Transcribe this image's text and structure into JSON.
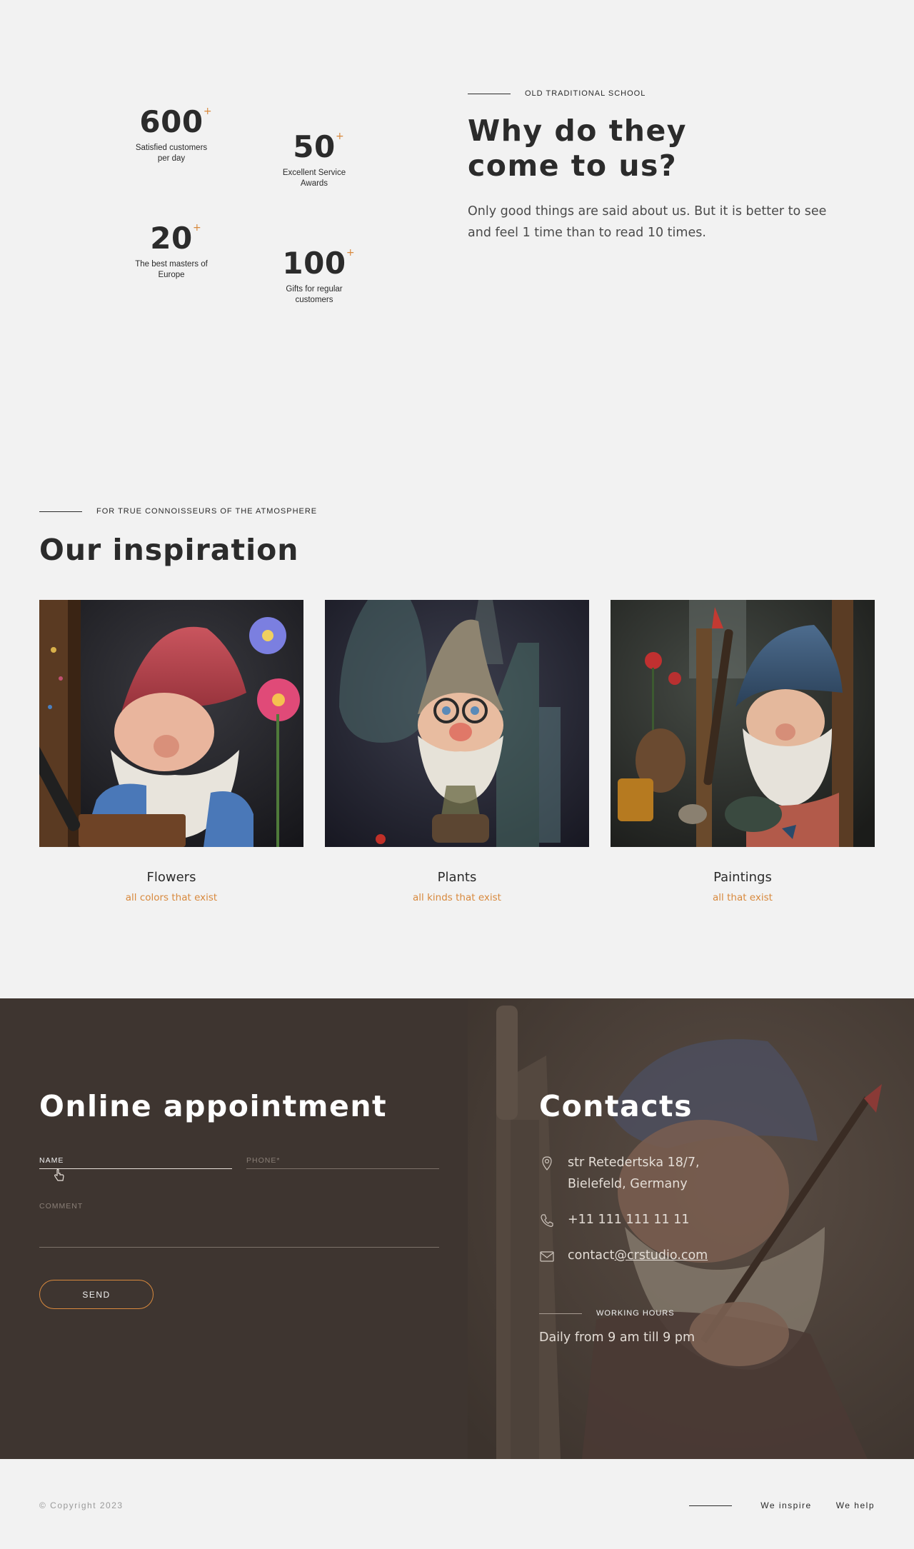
{
  "stats": [
    {
      "number": "600",
      "plus": "+",
      "caption_line1": "Satisfied customers",
      "caption_line2": "per day"
    },
    {
      "number": "50",
      "plus": "+",
      "caption_line1": "Excellent Service",
      "caption_line2": "Awards"
    },
    {
      "number": "20",
      "plus": "+",
      "caption_line1": "The best masters of",
      "caption_line2": "Europe"
    },
    {
      "number": "100",
      "plus": "+",
      "caption_line1": "Gifts for regular",
      "caption_line2": "customers"
    }
  ],
  "why": {
    "eyebrow": "OLD TRADITIONAL SCHOOL",
    "title": "Why do they come to us?",
    "text": "Only good things are said about us. But it is better to see and feel 1 time than to read 10 times."
  },
  "inspiration": {
    "eyebrow": "FOR TRUE CONNOISSEURS OF THE ATMOSPHERE",
    "title": "Our inspiration",
    "cards": [
      {
        "title": "Flowers",
        "subtitle": "all colors that exist"
      },
      {
        "title": "Plants",
        "subtitle": "all kinds that exist"
      },
      {
        "title": "Paintings",
        "subtitle": "all that exist"
      }
    ]
  },
  "appointment": {
    "title": "Online appointment",
    "name_label": "NAME",
    "phone_label": "PHONE*",
    "comment_label": "COMMENT",
    "send_label": "SEND"
  },
  "contacts": {
    "title": "Contacts",
    "address_line1": "str Retedertska 18/7,",
    "address_line2": "Bielefeld, Germany",
    "phone": "+11 111 111 11 11",
    "email_prefix": "contact",
    "email_link": "@crstudio.com",
    "hours_eyebrow": "WORKING HOURS",
    "hours": "Daily from 9 am till 9 pm"
  },
  "footer": {
    "copyright": "© Copyright 2023",
    "nav": [
      "We inspire",
      "We help"
    ]
  },
  "colors": {
    "accent": "#d8893d",
    "dark_bg": "#3e3530",
    "page_bg": "#f2f2f2",
    "text": "#2b2b2b"
  }
}
